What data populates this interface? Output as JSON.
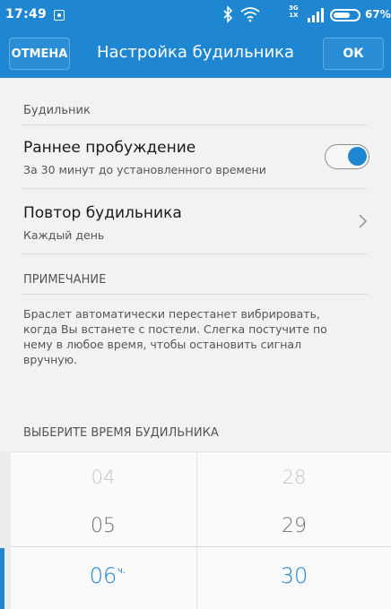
{
  "status_bar": {
    "time": "17:49",
    "network_top": "3G",
    "network_bottom": "1X",
    "battery": "67%"
  },
  "app_bar": {
    "cancel_label": "ОТМЕНА",
    "title": "Настройка будильника",
    "ok_label": "ОК"
  },
  "alarm_section": {
    "label": "Будильник",
    "early_wake": {
      "title": "Раннее пробуждение",
      "subtitle": "За 30 минут до установленного времени",
      "enabled": true
    },
    "repeat": {
      "title": "Повтор будильника",
      "subtitle": "Каждый день"
    }
  },
  "note": {
    "label": "ПРИМЕЧАНИЕ",
    "text": "Браслет автоматически перестанет вибрировать, когда Вы встанете с постели. Слегка постучите по нему в любое время, чтобы остановить сигнал вручную."
  },
  "time_picker": {
    "label": "ВЫБЕРИТЕ ВРЕМЯ БУДИЛЬНИКА",
    "hours": [
      "04",
      "05",
      "06"
    ],
    "hour_unit": "ч.",
    "minutes": [
      "28",
      "29",
      "30"
    ],
    "selected_hour": "06",
    "selected_minute": "30"
  },
  "colors": {
    "accent": "#1f86d2",
    "background": "#f2f2f2"
  },
  "icons": {
    "notification": "notification-icon",
    "bluetooth": "bluetooth-icon",
    "wifi": "wifi-icon",
    "signal": "signal-icon",
    "battery": "battery-icon",
    "repeat_chevron": "chevron-right-icon"
  }
}
